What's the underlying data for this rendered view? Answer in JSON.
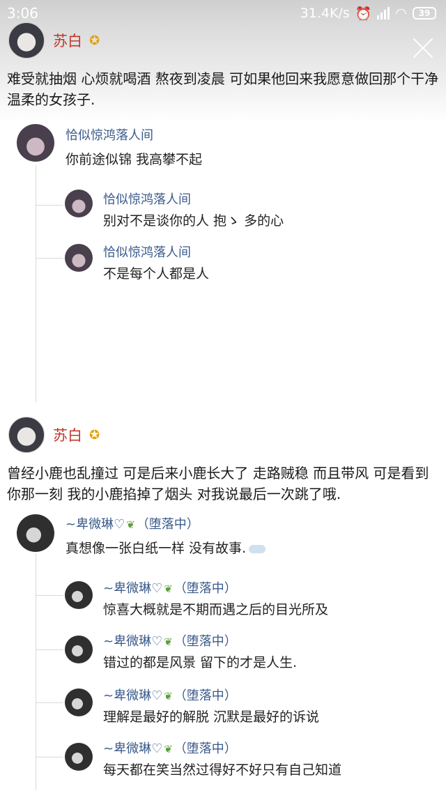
{
  "status_bar": {
    "time": "3:06",
    "net_speed": "31.4K/s",
    "battery": "39"
  },
  "posts": [
    {
      "author": "苏白",
      "text": "难受就抽烟 心烦就喝酒 熬夜到凌晨 可如果他回来我愿意做回那个干净温柔的女孩子.",
      "comment": {
        "name": "恰似惊鸿落人间",
        "text": "你前途似锦 我高攀不起"
      },
      "replies": [
        {
          "name": "恰似惊鸿落人间",
          "text": "别对不是谈你的人 抱ゝ 多的心"
        },
        {
          "name": "恰似惊鸿落人间",
          "text": "不是每个人都是人"
        }
      ]
    },
    {
      "author": "苏白",
      "text": "曾经小鹿也乱撞过 可是后来小鹿长大了 走路贼稳 而且带风 可是看到你那一刻 我的小鹿掐掉了烟头 对我说最后一次跳了哦.",
      "comment": {
        "name": "~卑微琳♡",
        "status": "（堕落中）",
        "text": "真想像一张白纸一样 没有故事."
      },
      "replies": [
        {
          "name": "~卑微琳♡",
          "status": "（堕落中）",
          "text": "惊喜大概就是不期而遇之后的目光所及"
        },
        {
          "name": "~卑微琳♡",
          "status": "（堕落中）",
          "text": "错过的都是风景 留下的才是人生."
        },
        {
          "name": "~卑微琳♡",
          "status": "（堕落中）",
          "text": "理解是最好的解脱 沉默是最好的诉说"
        },
        {
          "name": "~卑微琳♡",
          "status": "（堕落中）",
          "text": "每天都在笑当然过得好不好只有自己知道"
        }
      ]
    }
  ]
}
